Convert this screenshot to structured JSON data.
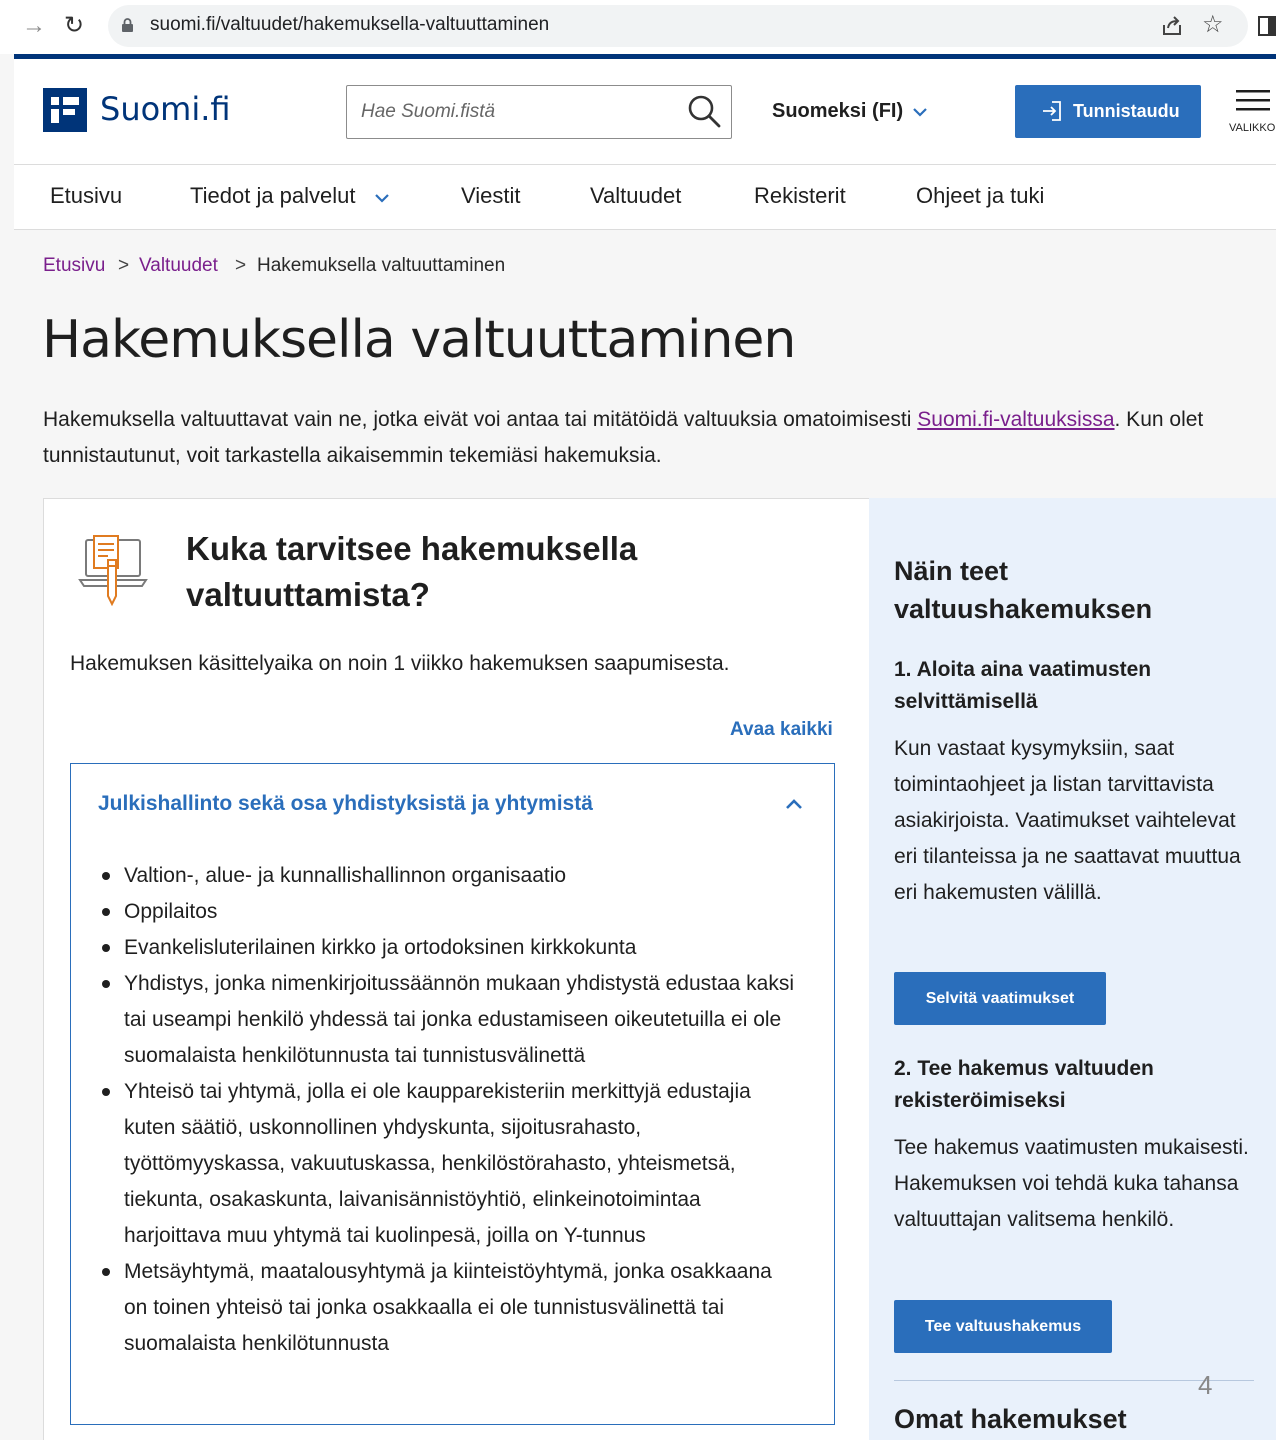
{
  "browser": {
    "url": "suomi.fi/valtuudet/hakemuksella-valtuuttaminen"
  },
  "header": {
    "logo_text": "Suomi.fi",
    "search_placeholder": "Hae Suomi.fistä",
    "language": "Suomeksi (FI)",
    "login_label": "Tunnistaudu",
    "menu_label": "VALIKKO",
    "brand_color": "#003479",
    "accent_color": "#2a6ebb"
  },
  "nav": {
    "items": [
      "Etusivu",
      "Tiedot ja palvelut",
      "Viestit",
      "Valtuudet",
      "Rekisterit",
      "Ohjeet ja tuki"
    ]
  },
  "breadcrumb": {
    "items": [
      "Etusivu",
      "Valtuudet",
      "Hakemuksella valtuuttaminen"
    ],
    "separator": ">"
  },
  "page": {
    "title": "Hakemuksella valtuuttaminen",
    "intro_before": "Hakemuksella valtuuttavat vain ne, jotka eivät voi antaa tai mitätöidä valtuuksia omatoimisesti ",
    "intro_link": "Suomi.fi-valtuuksissa",
    "intro_after": ". Kun olet tunnistautunut, voit tarkastella aikaisemmin tekemiäsi hakemuksia."
  },
  "card": {
    "title": "Kuka tarvitsee hakemuksella valtuuttamista?",
    "lead": "Hakemuksen käsittelyaika on noin 1 viikko hakemuksen saapumisesta.",
    "open_all": "Avaa kaikki",
    "accordion": {
      "title": "Julkishallinto sekä osa yhdistyksistä ja yhtymistä",
      "items": [
        "Valtion-, alue- ja kunnallishallinnon organisaatio",
        "Oppilaitos",
        "Evankelisluterilainen kirkko ja ortodoksinen kirkkokunta",
        "Yhdistys, jonka nimenkirjoitussäännön mukaan yhdistystä edustaa kaksi tai useampi henkilö yhdessä tai jonka edustamiseen oikeutetuilla ei ole suomalaista henkilötunnusta tai tunnistusvälinettä",
        "Yhteisö tai yhtymä, jolla ei ole kaupparekisteriin merkittyjä edustajia kuten säätiö, uskonnollinen yhdyskunta, sijoitusrahasto, työttömyyskassa, vakuutuskassa, henkilöstörahasto, yhteismetsä, tiekunta, osakaskunta, laivanisännistöyhtiö, elinkeinotoimintaa harjoittava muu yhtymä tai kuolinpesä, joilla on Y-tunnus",
        "Metsäyhtymä, maatalousyhtymä ja kiinteistöyhtymä, jonka osakkaana on toinen yhteisö tai jonka osakkaalla ei ole tunnistusvälinettä tai suomalaista henkilötunnusta"
      ]
    }
  },
  "sidebar": {
    "title": "Näin teet valtuushakemuksen",
    "step1_title": "1. Aloita aina vaatimusten selvittämisellä",
    "step1_text": "Kun vastaat kysymyksiin, saat toimintaohjeet ja listan tarvittavista asiakirjoista. Vaatimukset vaihtelevat eri tilanteissa ja ne saattavat muuttua eri hakemusten välillä.",
    "step1_button": "Selvitä vaatimukset",
    "step2_title": "2. Tee hakemus valtuuden rekisteröimiseksi",
    "step2_text": "Tee hakemus vaatimusten mukaisesti. Hakemuksen voi tehdä kuka tahansa valtuuttajan valitsema henkilö.",
    "step2_button": "Tee valtuushakemus",
    "count": "4",
    "subhead": "Omat hakemukset"
  }
}
